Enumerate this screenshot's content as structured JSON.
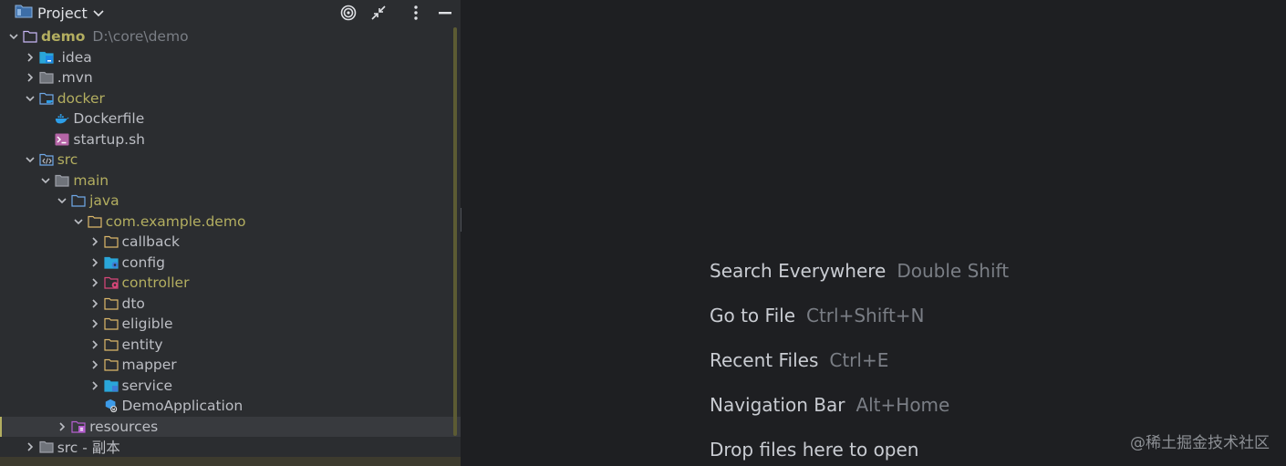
{
  "header": {
    "title": "Project"
  },
  "tree": [
    {
      "label": "demo",
      "path": "D:\\core\\demo",
      "indent": 0,
      "arrow": "down",
      "icon": "module-folder-icon",
      "style": "bold"
    },
    {
      "label": ".idea",
      "indent": 1,
      "arrow": "right",
      "icon": "idea-folder-icon",
      "style": "normal"
    },
    {
      "label": ".mvn",
      "indent": 1,
      "arrow": "right",
      "icon": "folder-icon",
      "style": "normal"
    },
    {
      "label": "docker",
      "indent": 1,
      "arrow": "down",
      "icon": "docker-folder-icon",
      "style": "mod"
    },
    {
      "label": "Dockerfile",
      "indent": 2,
      "arrow": "none",
      "icon": "docker-icon",
      "style": "normal"
    },
    {
      "label": "startup.sh",
      "indent": 2,
      "arrow": "none",
      "icon": "shell-script-icon",
      "style": "normal"
    },
    {
      "label": "src",
      "indent": 1,
      "arrow": "down",
      "icon": "source-folder-icon",
      "style": "mod"
    },
    {
      "label": "main",
      "indent": 2,
      "arrow": "down",
      "icon": "folder-icon",
      "style": "mod"
    },
    {
      "label": "java",
      "indent": 3,
      "arrow": "down",
      "icon": "java-folder-icon",
      "style": "mod"
    },
    {
      "label": "com.example.demo",
      "indent": 4,
      "arrow": "down",
      "icon": "package-icon",
      "style": "mod"
    },
    {
      "label": "callback",
      "indent": 5,
      "arrow": "right",
      "icon": "package-icon",
      "style": "normal"
    },
    {
      "label": "config",
      "indent": 5,
      "arrow": "right",
      "icon": "config-package-icon",
      "style": "normal"
    },
    {
      "label": "controller",
      "indent": 5,
      "arrow": "right",
      "icon": "controller-package-icon",
      "style": "mod"
    },
    {
      "label": "dto",
      "indent": 5,
      "arrow": "right",
      "icon": "package-icon",
      "style": "normal"
    },
    {
      "label": "eligible",
      "indent": 5,
      "arrow": "right",
      "icon": "package-icon",
      "style": "normal"
    },
    {
      "label": "entity",
      "indent": 5,
      "arrow": "right",
      "icon": "package-icon",
      "style": "normal"
    },
    {
      "label": "mapper",
      "indent": 5,
      "arrow": "right",
      "icon": "package-icon",
      "style": "normal"
    },
    {
      "label": "service",
      "indent": 5,
      "arrow": "right",
      "icon": "service-package-icon",
      "style": "normal"
    },
    {
      "label": "DemoApplication",
      "indent": 5,
      "arrow": "none",
      "icon": "spring-boot-class-icon",
      "style": "normal"
    },
    {
      "label": "resources",
      "indent": 3,
      "arrow": "right",
      "icon": "resources-folder-icon",
      "style": "normal",
      "selected": true
    },
    {
      "label": "src - 副本",
      "indent": 1,
      "arrow": "right",
      "icon": "folder-icon",
      "style": "normal"
    }
  ],
  "hints": [
    {
      "action": "Search Everywhere",
      "shortcut": "Double Shift"
    },
    {
      "action": "Go to File",
      "shortcut": "Ctrl+Shift+N"
    },
    {
      "action": "Recent Files",
      "shortcut": "Ctrl+E"
    },
    {
      "action": "Navigation Bar",
      "shortcut": "Alt+Home"
    },
    {
      "action": "Drop files here to open",
      "shortcut": ""
    }
  ],
  "watermark": "@稀土掘金技术社区",
  "colors": {
    "panel": "#2b2d30",
    "editor": "#1e1f22",
    "modified": "#b3ae60",
    "muted": "#7a7e85"
  }
}
